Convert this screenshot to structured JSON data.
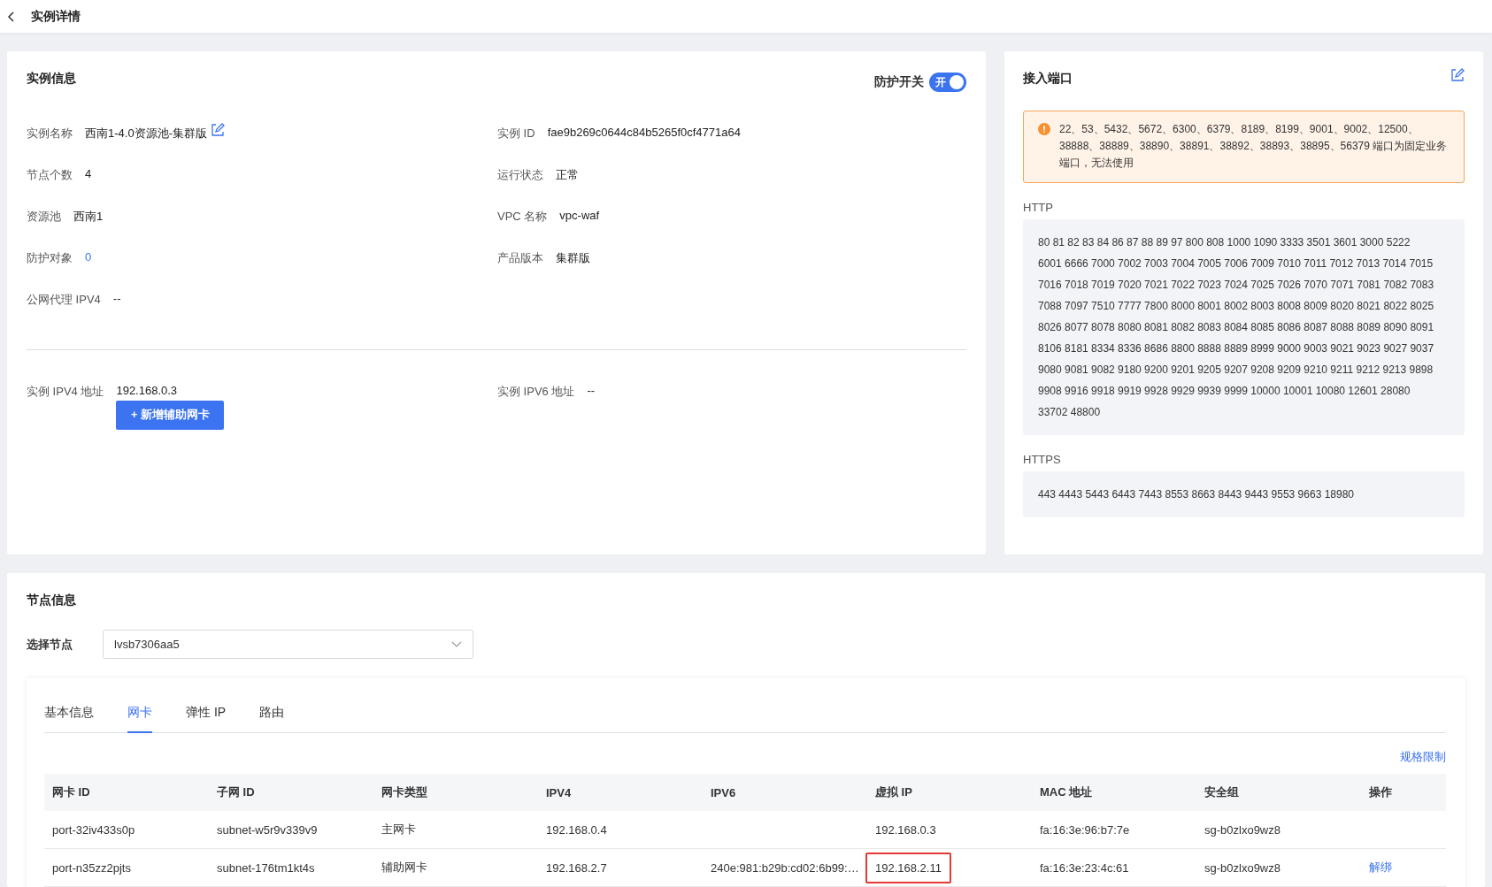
{
  "header": {
    "title": "实例详情"
  },
  "instance_info": {
    "title": "实例信息",
    "protection_toggle": {
      "label": "防护开关",
      "text": "开",
      "on": true
    },
    "fields": [
      {
        "label": "实例名称",
        "value": "西南1-4.0资源池-集群版",
        "kind": "editable"
      },
      {
        "label": "实例 ID",
        "value": "fae9b269c0644c84b5265f0cf4771a64",
        "kind": "text"
      },
      {
        "label": "节点个数",
        "value": "4",
        "kind": "text"
      },
      {
        "label": "运行状态",
        "value": "正常",
        "kind": "text"
      },
      {
        "label": "资源池",
        "value": "西南1",
        "kind": "text"
      },
      {
        "label": "VPC 名称",
        "value": "vpc-waf",
        "kind": "text"
      },
      {
        "label": "防护对象",
        "value": "0",
        "kind": "link"
      },
      {
        "label": "产品版本",
        "value": "集群版",
        "kind": "text"
      },
      {
        "label": "公网代理 IPV4",
        "value": "--",
        "kind": "text"
      }
    ],
    "address_fields": [
      {
        "label": "实例 IPV4 地址",
        "value": "192.168.0.3",
        "button": "+ 新增辅助网卡"
      },
      {
        "label": "实例 IPV6 地址",
        "value": "--"
      }
    ]
  },
  "access_ports": {
    "title": "接入端口",
    "warning": "22、53、5432、5672、6300、6379、8189、8199、9001、9002、12500、38888、38889、38890、38891、38892、38893、38895、56379 端口为固定业务端口，无法使用",
    "groups": [
      {
        "label": "HTTP",
        "ports": "80 81 82 83 84 86 87 88 89 97 800 808 1000 1090 3333 3501 3601 3000 5222 6001 6666 7000 7002 7003 7004 7005 7006 7009 7010 7011 7012 7013 7014 7015 7016 7018 7019 7020 7021 7022 7023 7024 7025 7026 7070 7071 7081 7082 7083 7088 7097 7510 7777 7800 8000 8001 8002 8003 8008 8009 8020 8021 8022 8025 8026 8077 8078 8080 8081 8082 8083 8084 8085 8086 8087 8088 8089 8090 8091 8106 8181 8334 8336 8686 8800 8888 8889 8999 9000 9003 9021 9023 9027 9037 9080 9081 9082 9180 9200 9201 9205 9207 9208 9209 9210 9211 9212 9213 9898 9908 9916 9918 9919 9928 9929 9939 9999 10000 10001 10080 12601 28080 33702 48800"
      },
      {
        "label": "HTTPS",
        "ports": "443 4443 5443 6443 7443 8553 8663 8443 9443 9553 9663 18980"
      }
    ]
  },
  "node_info": {
    "title": "节点信息",
    "node_select": {
      "label": "选择节点",
      "value": "lvsb7306aa5"
    },
    "tabs": [
      {
        "label": "基本信息",
        "selected": false
      },
      {
        "label": "网卡",
        "selected": true
      },
      {
        "label": "弹性 IP",
        "selected": false
      },
      {
        "label": "路由",
        "selected": false
      }
    ],
    "limits_link": "规格限制",
    "table": {
      "columns": [
        "网卡 ID",
        "子网 ID",
        "网卡类型",
        "IPV4",
        "IPV6",
        "虚拟 IP",
        "MAC 地址",
        "安全组",
        "操作"
      ],
      "rows": [
        {
          "cells": [
            {
              "kind": "text",
              "text": "port-32iv433s0p"
            },
            {
              "kind": "text",
              "text": "subnet-w5r9v339v9"
            },
            {
              "kind": "text",
              "text": "主网卡"
            },
            {
              "kind": "text",
              "text": "192.168.0.4"
            },
            {
              "kind": "empty"
            },
            {
              "kind": "text",
              "text": "192.168.0.3"
            },
            {
              "kind": "text",
              "text": "fa:16:3e:96:b7:7e"
            },
            {
              "kind": "text",
              "text": "sg-b0zlxo9wz8"
            },
            {
              "kind": "empty"
            }
          ]
        },
        {
          "cells": [
            {
              "kind": "text",
              "text": "port-n35zz2pjts"
            },
            {
              "kind": "text",
              "text": "subnet-176tm1kt4s"
            },
            {
              "kind": "text",
              "text": "辅助网卡"
            },
            {
              "kind": "text",
              "text": "192.168.2.7"
            },
            {
              "kind": "text",
              "text": "240e:981:b29b:cd02:6b99:…"
            },
            {
              "kind": "marked",
              "text": "192.168.2.11"
            },
            {
              "kind": "text",
              "text": "fa:16:3e:23:4c:61"
            },
            {
              "kind": "text",
              "text": "sg-b0zlxo9wz8"
            },
            {
              "kind": "link",
              "text": "解绑"
            }
          ]
        }
      ]
    }
  }
}
